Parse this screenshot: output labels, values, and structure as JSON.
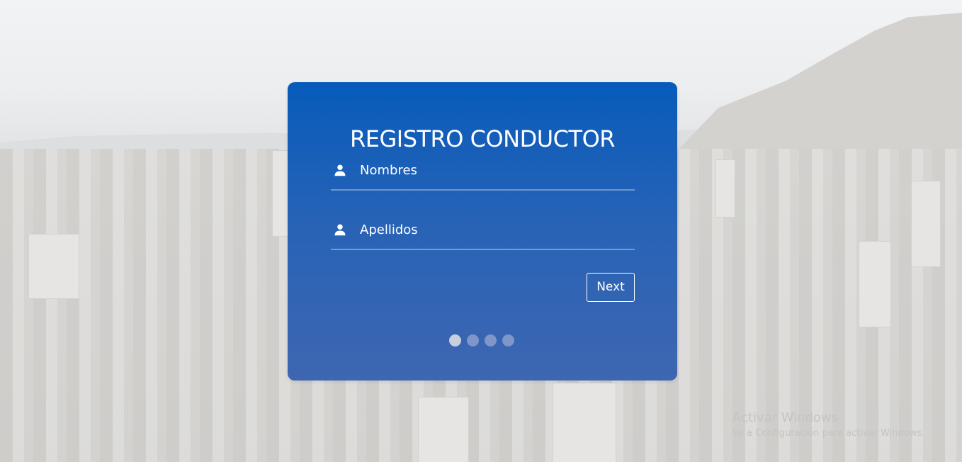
{
  "form": {
    "title": "REGISTRO CONDUCTOR",
    "fields": [
      {
        "label": "Nombres",
        "icon": "user-icon"
      },
      {
        "label": "Apellidos",
        "icon": "user-icon"
      }
    ],
    "next_label": "Next",
    "steps": {
      "total": 4,
      "current": 1
    }
  },
  "watermark": {
    "title": "Activar Windows",
    "subtitle": "Ve a Configuración para activar Windows."
  },
  "colors": {
    "card_top": "#075bbb",
    "card_bottom": "#3e66b1",
    "text": "#ffffff",
    "dot_active": "#c8cfdc",
    "dot_inactive": "#7e96c8"
  }
}
